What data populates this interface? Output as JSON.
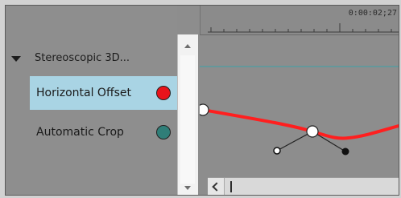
{
  "group": {
    "label": "Stereoscopic 3D..."
  },
  "parameters": [
    {
      "label": "Horizontal Offset",
      "selected": true,
      "dot_color": "#e8141b"
    },
    {
      "label": "Automatic Crop",
      "selected": false,
      "dot_color": "#2f7e78"
    }
  ],
  "timeline": {
    "timecode": "0:00:02;27",
    "curve_color": "#ff1f1f",
    "guide_color": "#3aa3a9"
  }
}
